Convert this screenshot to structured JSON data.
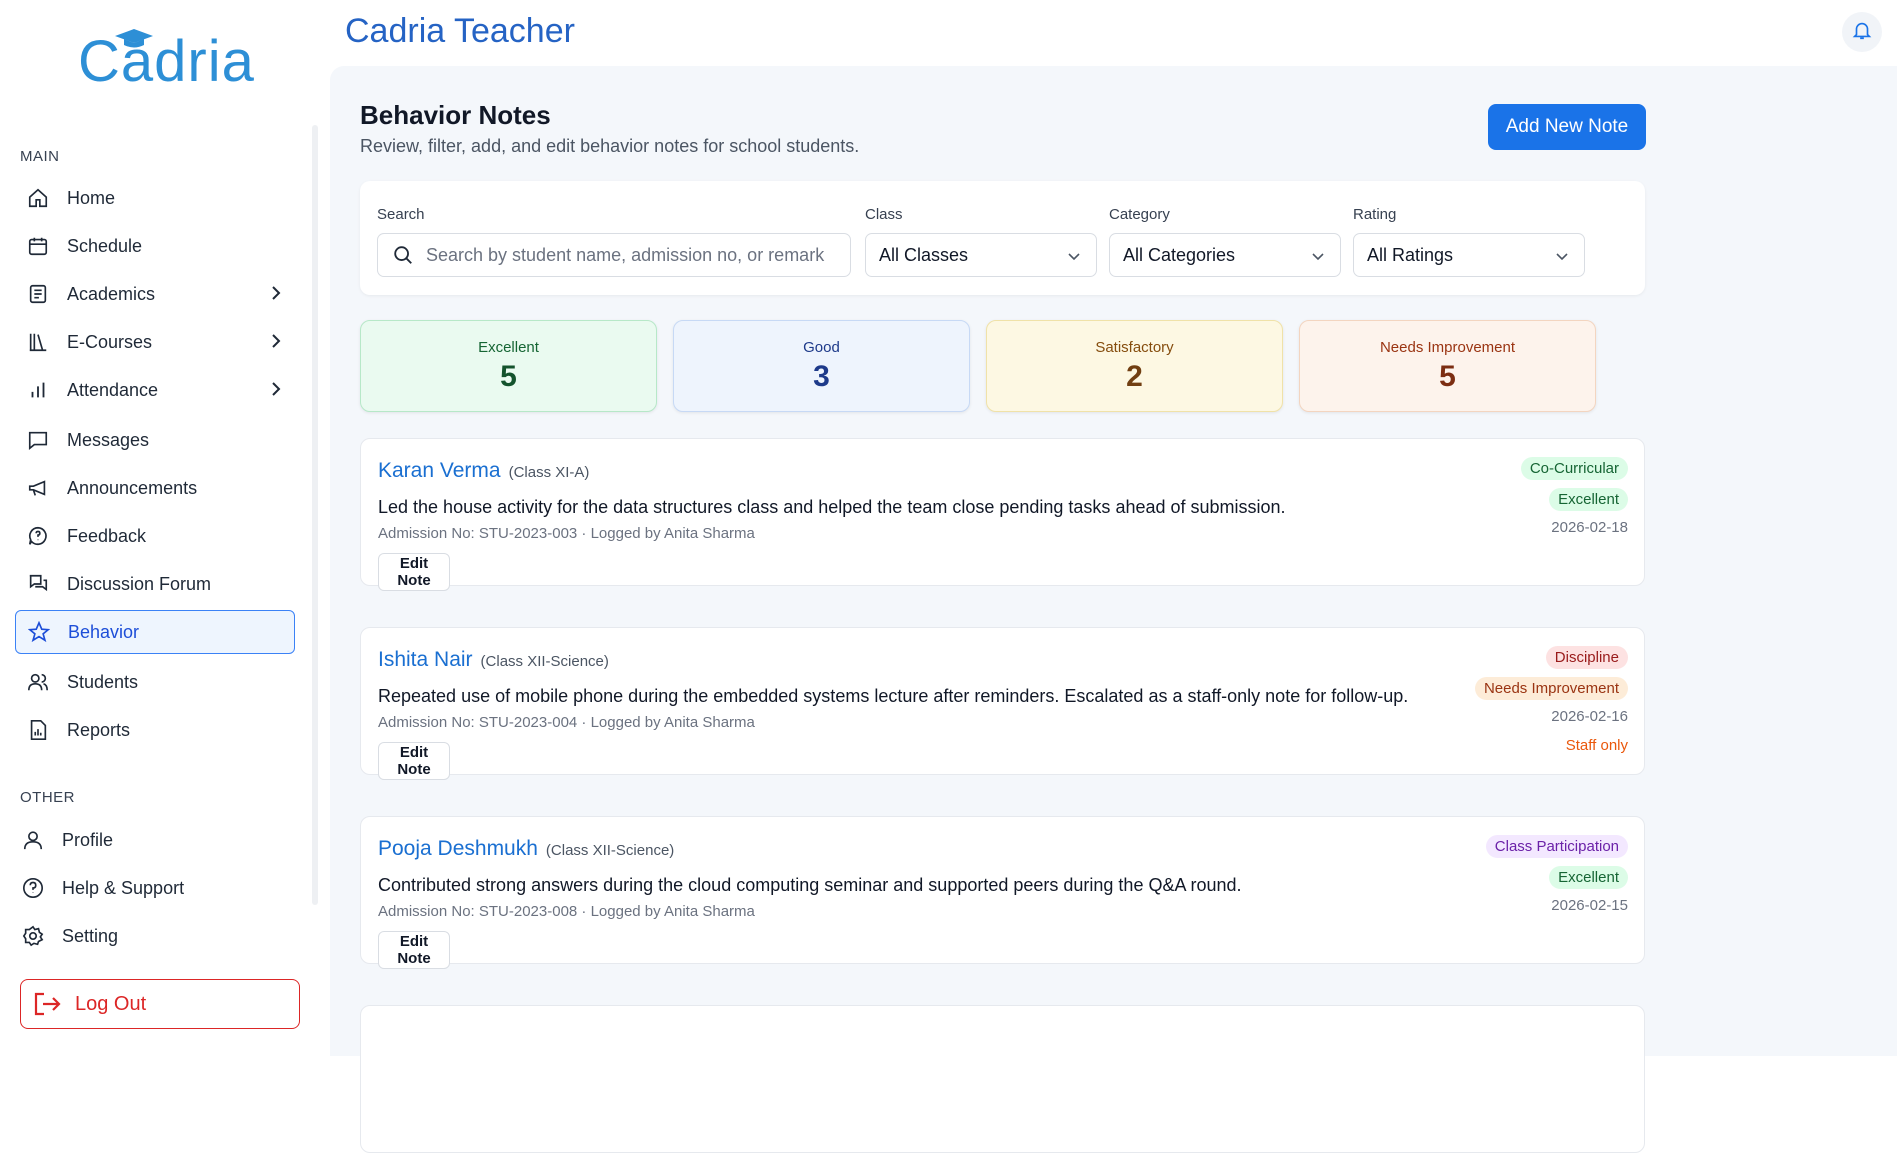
{
  "brand": {
    "logo_text": "Cadria"
  },
  "header": {
    "title": "Cadria Teacher"
  },
  "sidebar": {
    "main_label": "MAIN",
    "items": [
      {
        "label": "Home",
        "icon": "home-icon"
      },
      {
        "label": "Schedule",
        "icon": "calendar-icon"
      },
      {
        "label": "Academics",
        "icon": "document-icon",
        "expandable": true
      },
      {
        "label": "E-Courses",
        "icon": "books-icon",
        "expandable": true
      },
      {
        "label": "Attendance",
        "icon": "bar-chart-icon",
        "expandable": true
      },
      {
        "label": "Messages",
        "icon": "message-icon"
      },
      {
        "label": "Announcements",
        "icon": "megaphone-icon"
      },
      {
        "label": "Feedback",
        "icon": "feedback-icon"
      },
      {
        "label": "Discussion Forum",
        "icon": "forum-icon"
      },
      {
        "label": "Behavior",
        "icon": "star-icon",
        "active": true
      },
      {
        "label": "Students",
        "icon": "users-icon"
      },
      {
        "label": "Reports",
        "icon": "report-icon"
      }
    ],
    "other_label": "OTHER",
    "other_items": [
      {
        "label": "Profile",
        "icon": "user-icon"
      },
      {
        "label": "Help & Support",
        "icon": "help-icon"
      },
      {
        "label": "Setting",
        "icon": "gear-icon"
      }
    ],
    "logout_label": "Log Out"
  },
  "page": {
    "title": "Behavior Notes",
    "subtitle": "Review, filter, add, and edit behavior notes for school students.",
    "add_button": "Add New Note"
  },
  "filters": {
    "search_label": "Search",
    "search_placeholder": "Search by student name, admission no, or remark",
    "class_label": "Class",
    "class_value": "All Classes",
    "category_label": "Category",
    "category_value": "All Categories",
    "rating_label": "Rating",
    "rating_value": "All Ratings"
  },
  "stats": [
    {
      "label": "Excellent",
      "value": "5",
      "bg": "#eafaf0",
      "border": "#b7e8c8",
      "label_color": "#166534",
      "value_color": "#14532d"
    },
    {
      "label": "Good",
      "value": "3",
      "bg": "#eef4fd",
      "border": "#c7d9f5",
      "label_color": "#1e3a8a",
      "value_color": "#1e3a8a"
    },
    {
      "label": "Satisfactory",
      "value": "2",
      "bg": "#fdf8e3",
      "border": "#f0e2a8",
      "label_color": "#854d0e",
      "value_color": "#713f12"
    },
    {
      "label": "Needs Improvement",
      "value": "5",
      "bg": "#fdf3ec",
      "border": "#f3d5c0",
      "label_color": "#9a3412",
      "value_color": "#7c2d12"
    }
  ],
  "notes": [
    {
      "name": "Karan Verma",
      "class": "(Class XI-A)",
      "remark": "Led the house activity for the data structures class and helped the team close pending tasks ahead of submission.",
      "meta": "Admission No: STU-2023-003 · Logged by Anita Sharma",
      "category": "Co-Curricular",
      "category_bg": "#dcfce7",
      "category_color": "#166534",
      "rating": "Excellent",
      "rating_bg": "#dcfce7",
      "rating_color": "#166534",
      "date": "2026-02-18",
      "staff": "",
      "edit_label": "Edit Note"
    },
    {
      "name": "Ishita Nair",
      "class": "(Class XII-Science)",
      "remark": "Repeated use of mobile phone during the embedded systems lecture after reminders. Escalated as a staff-only note for follow-up.",
      "meta": "Admission No: STU-2023-004 · Logged by Anita Sharma",
      "category": "Discipline",
      "category_bg": "#fde2e2",
      "category_color": "#991b1b",
      "rating": "Needs Improvement",
      "rating_bg": "#fdecd8",
      "rating_color": "#9a3412",
      "date": "2026-02-16",
      "staff": "Staff only",
      "edit_label": "Edit Note"
    },
    {
      "name": "Pooja Deshmukh",
      "class": "(Class XII-Science)",
      "remark": "Contributed strong answers during the cloud computing seminar and supported peers during the Q&A round.",
      "meta": "Admission No: STU-2023-008 · Logged by Anita Sharma",
      "category": "Class Participation",
      "category_bg": "#f3e8ff",
      "category_color": "#6b21a8",
      "rating": "Excellent",
      "rating_bg": "#dcfce7",
      "rating_color": "#166534",
      "date": "2026-02-15",
      "staff": "",
      "edit_label": "Edit Note"
    }
  ]
}
